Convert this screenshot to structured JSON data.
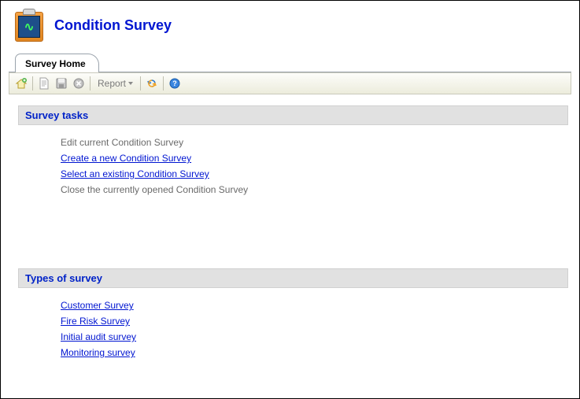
{
  "page_title": "Condition Survey",
  "tab_label": "Survey Home",
  "toolbar": {
    "report_label": "Report"
  },
  "sections": {
    "tasks": {
      "header": "Survey tasks",
      "items": [
        {
          "label": "Edit current Condition Survey",
          "link": false
        },
        {
          "label": "Create a new Condition Survey",
          "link": true
        },
        {
          "label": "Select an existing Condition Survey",
          "link": true
        },
        {
          "label": "Close the currently opened Condition Survey",
          "link": false
        }
      ]
    },
    "types": {
      "header": "Types of survey",
      "items": [
        {
          "label": "Customer Survey",
          "link": true
        },
        {
          "label": "Fire Risk Survey",
          "link": true
        },
        {
          "label": "Initial audit survey",
          "link": true
        },
        {
          "label": "Monitoring survey",
          "link": true
        }
      ]
    }
  }
}
